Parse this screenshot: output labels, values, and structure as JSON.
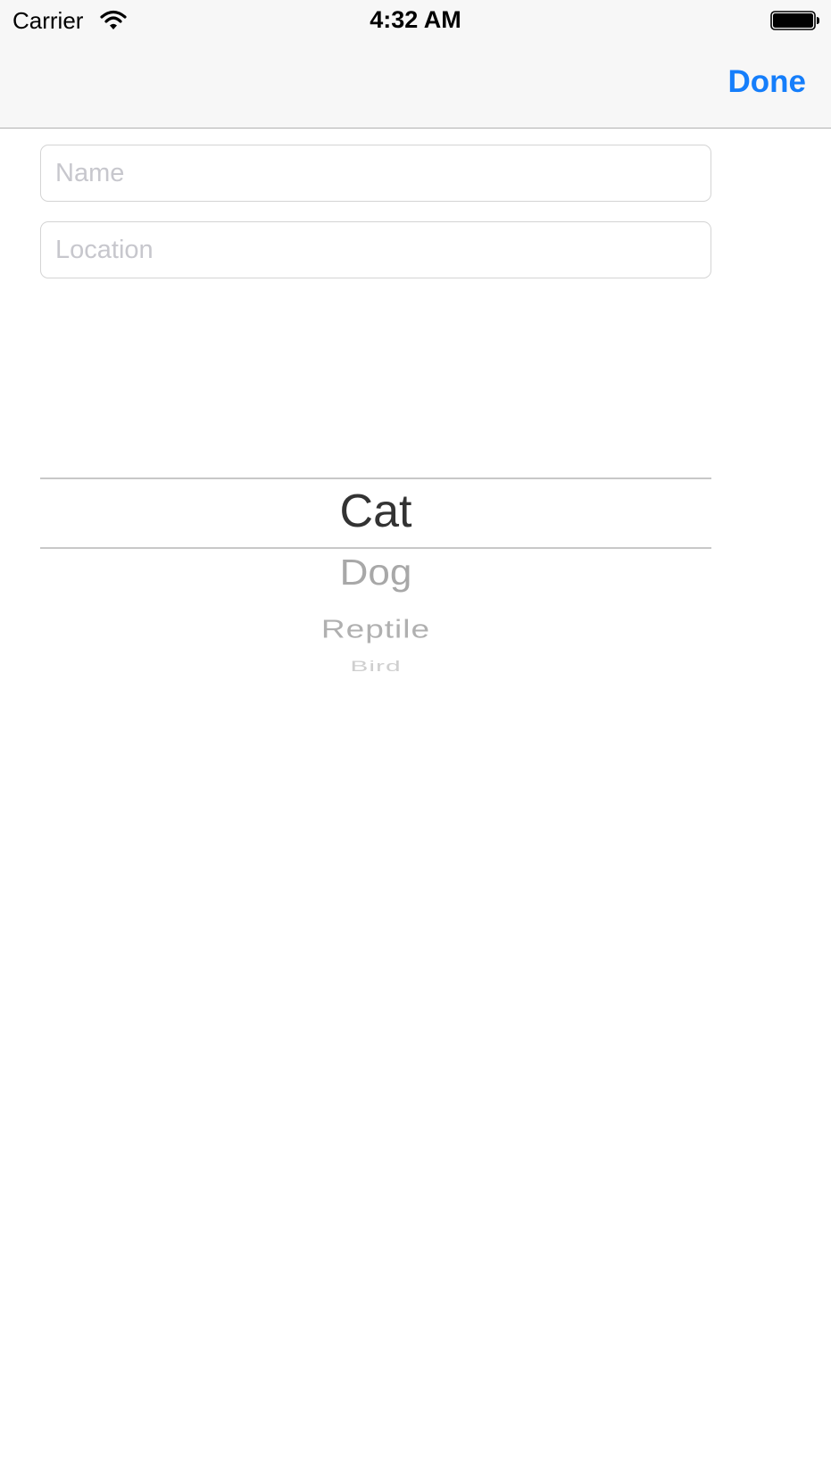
{
  "status_bar": {
    "carrier": "Carrier",
    "time": "4:32 AM",
    "wifi_icon": "wifi-icon",
    "battery_icon": "battery-full-icon"
  },
  "nav_bar": {
    "done_label": "Done",
    "accent_color": "#157efb"
  },
  "form": {
    "name": {
      "value": "",
      "placeholder": "Name"
    },
    "location": {
      "value": "",
      "placeholder": "Location"
    }
  },
  "picker": {
    "selected": "Cat",
    "options": [
      "Cat",
      "Dog",
      "Reptile",
      "Bird"
    ]
  }
}
